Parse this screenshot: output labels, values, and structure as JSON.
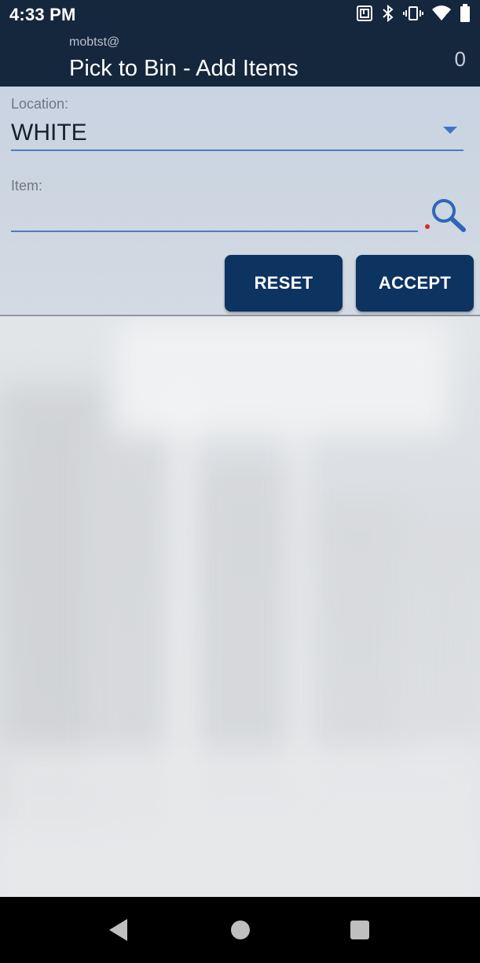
{
  "status_bar": {
    "time": "4:33 PM",
    "icons": [
      "nfc-icon",
      "bluetooth-icon",
      "vibrate-icon",
      "wifi-icon",
      "battery-icon"
    ]
  },
  "header": {
    "user": "mobtst@",
    "title": "Pick to Bin - Add Items",
    "count": "0"
  },
  "form": {
    "location_label": "Location:",
    "location_value": "WHITE",
    "item_label": "Item:",
    "item_value": "",
    "reset_label": "RESET",
    "accept_label": "ACCEPT"
  },
  "navigation": {
    "buttons": [
      "back-icon",
      "home-icon",
      "recents-icon"
    ]
  },
  "colors": {
    "header_bg": "#15273c",
    "button_bg": "#0d3361",
    "accent": "#3f74c6",
    "required": "#e2262b"
  }
}
